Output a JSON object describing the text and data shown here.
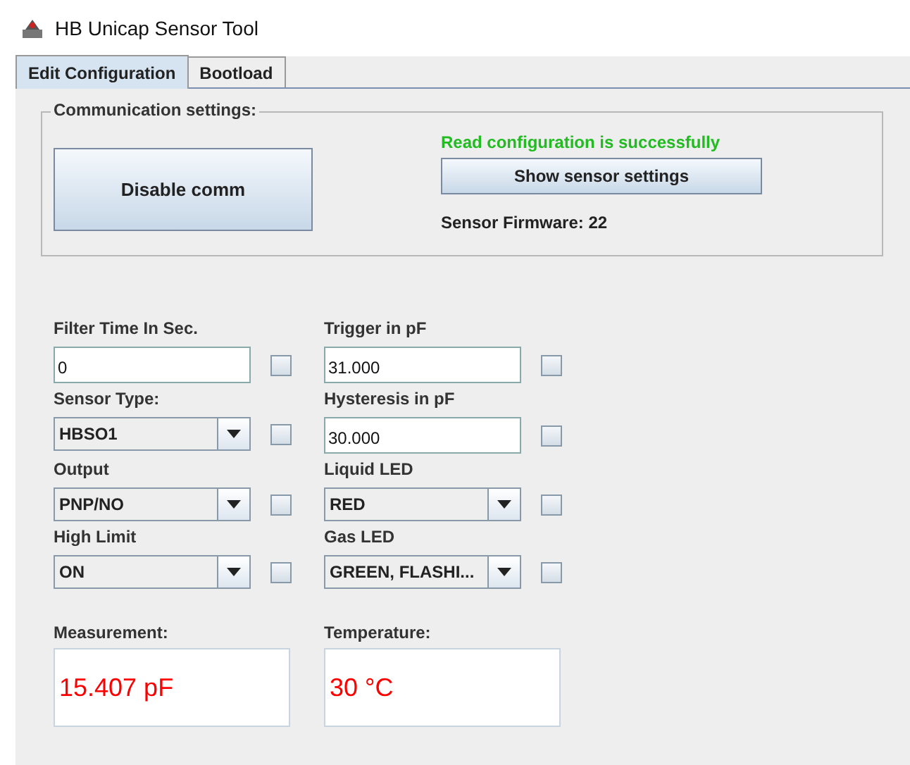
{
  "window": {
    "title": "HB Unicap Sensor Tool"
  },
  "tabs": [
    {
      "label": "Edit Configuration",
      "selected": true
    },
    {
      "label": "Bootload",
      "selected": false
    }
  ],
  "communication": {
    "title": "Communication settings:",
    "disable_button": "Disable comm",
    "status": "Read configuration is successfully",
    "show_button": "Show sensor settings",
    "firmware": "Sensor Firmware: 22"
  },
  "fields": [
    {
      "label": "Filter Time In Sec.",
      "kind": "text",
      "value": "0",
      "checked": false
    },
    {
      "label": "Trigger in pF",
      "kind": "text",
      "value": "31.000",
      "checked": false
    },
    {
      "label": "Sensor Type:",
      "kind": "combo",
      "value": "HBSO1",
      "checked": false
    },
    {
      "label": "Hysteresis in pF",
      "kind": "text",
      "value": "30.000",
      "checked": false
    },
    {
      "label": "Output",
      "kind": "combo",
      "value": "PNP/NO",
      "checked": false
    },
    {
      "label": "Liquid LED",
      "kind": "combo",
      "value": "RED",
      "checked": false
    },
    {
      "label": "High Limit",
      "kind": "combo",
      "value": "ON",
      "checked": false
    },
    {
      "label": "Gas LED",
      "kind": "combo",
      "value": "GREEN, FLASHI...",
      "checked": false
    }
  ],
  "readings": [
    {
      "label": "Measurement:",
      "value": "15.407 pF"
    },
    {
      "label": "Temperature:",
      "value": "30 °C"
    }
  ]
}
